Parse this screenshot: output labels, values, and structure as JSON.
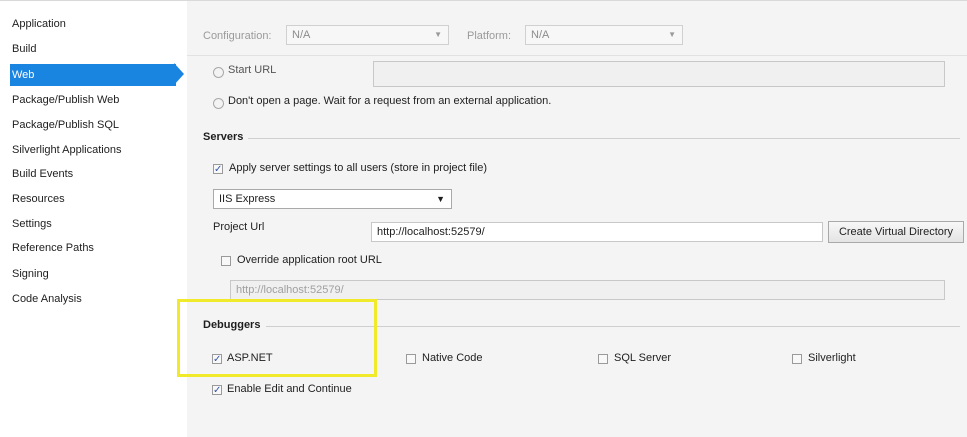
{
  "sidebar": {
    "items": [
      {
        "label": "Application"
      },
      {
        "label": "Build"
      },
      {
        "label": "Web"
      },
      {
        "label": "Package/Publish Web"
      },
      {
        "label": "Package/Publish SQL"
      },
      {
        "label": "Silverlight Applications"
      },
      {
        "label": "Build Events"
      },
      {
        "label": "Resources"
      },
      {
        "label": "Settings"
      },
      {
        "label": "Reference Paths"
      },
      {
        "label": "Signing"
      },
      {
        "label": "Code Analysis"
      }
    ],
    "selected": "Web"
  },
  "toolbar": {
    "configuration_label": "Configuration:",
    "configuration_value": "N/A",
    "platform_label": "Platform:",
    "platform_value": "N/A"
  },
  "start_action": {
    "start_url_label": "Start URL",
    "dont_open_label": "Don't open a page.  Wait for a request from an external application."
  },
  "servers": {
    "heading": "Servers",
    "apply_all_users_label": "Apply server settings to all users (store in project file)",
    "server_selected": "IIS Express",
    "project_url_label": "Project Url",
    "project_url_value": "http://localhost:52579/",
    "create_vdir_label": "Create Virtual Directory",
    "override_root_label": "Override application root URL",
    "override_root_value": "http://localhost:52579/"
  },
  "debuggers": {
    "heading": "Debuggers",
    "aspnet_label": "ASP.NET",
    "native_label": "Native Code",
    "sql_label": "SQL Server",
    "silverlight_label": "Silverlight",
    "edit_continue_label": "Enable Edit and Continue"
  },
  "colors": {
    "selection": "#1a84e1",
    "highlight": "#f1ea2a",
    "panel": "#f4f4f4"
  },
  "icons": {
    "checked": "✓",
    "dropdown": "▼"
  }
}
